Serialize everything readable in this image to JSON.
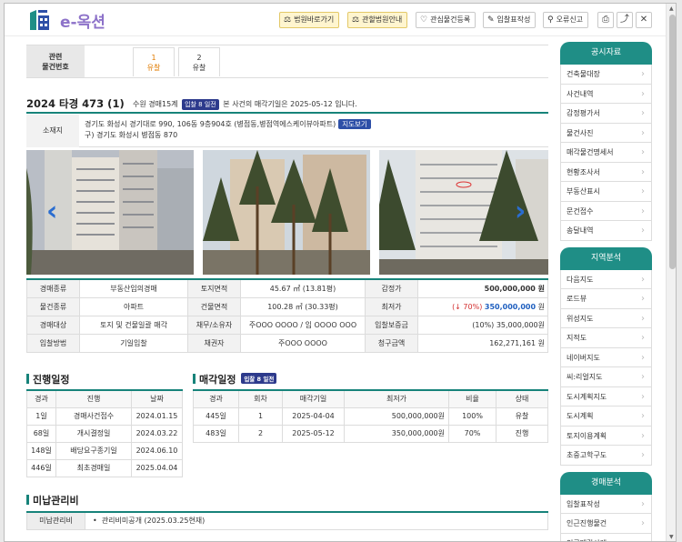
{
  "header": {
    "logo_text": "e-옥션",
    "buttons": [
      {
        "label": "법원바로가기",
        "icon": "gavel-icon",
        "style": "yellow"
      },
      {
        "label": "관할법원안내",
        "icon": "gavel-icon",
        "style": "yellow"
      },
      {
        "label": "관심물건등록",
        "icon": "heart-icon",
        "style": "plain"
      },
      {
        "label": "입찰표작성",
        "icon": "pencil-icon",
        "style": "plain"
      },
      {
        "label": "오류신고",
        "icon": "pin-icon",
        "style": "plain"
      }
    ],
    "icons": [
      "print-icon",
      "share-icon",
      "close-icon"
    ]
  },
  "tabs": {
    "head_line1": "관련",
    "head_line2": "물건번호",
    "items": [
      {
        "num": "1",
        "label": "유찰",
        "active": true
      },
      {
        "num": "2",
        "label": "유찰",
        "active": false
      }
    ]
  },
  "case": {
    "title": "2024 타경 473 (1)",
    "court": "수원 경매15계",
    "badge": "입찰 8 일전",
    "notice": "본 사건의 매각기일은 2025-05-12 입니다."
  },
  "location": {
    "label": "소재지",
    "line1": "경기도 화성시 경기대로 990, 106동 9층904호 (병점동,병점역에스케이뷰아파트)",
    "map_button": "지도보기",
    "line2": "구) 경기도 화성시 병점동 870"
  },
  "info_table": [
    [
      "경매종류",
      "부동산임의경매",
      "토지면적",
      "45.67 ㎡ (13.81평)",
      "감정가",
      "500,000,000 원"
    ],
    [
      "물건종류",
      "아파트",
      "건물면적",
      "100.28 ㎡ (30.33평)",
      "최저가",
      "(↓ 70%) 350,000,000 원"
    ],
    [
      "경매대상",
      "토지 및 건물일괄 매각",
      "채무/소유자",
      "주OOO OOOO / 임 OOOO OOO",
      "입찰보증금",
      "(10%) 35,000,000원"
    ],
    [
      "입찰방법",
      "기일입찰",
      "채권자",
      "주OOO OOOO",
      "청구금액",
      "162,271,161 원"
    ]
  ],
  "min_price": {
    "pct": "(↓ 70%)",
    "amount": "350,000,000",
    "unit": "원"
  },
  "progress": {
    "title": "진행일정",
    "columns": [
      "경과",
      "진행",
      "날짜"
    ],
    "rows": [
      [
        "1일",
        "경매사건접수",
        "2024.01.15"
      ],
      [
        "68일",
        "개시결정일",
        "2024.03.22"
      ],
      [
        "148일",
        "배당요구종기일",
        "2024.06.10"
      ],
      [
        "446일",
        "최초경매일",
        "2025.04.04"
      ]
    ]
  },
  "sale": {
    "title": "매각일정",
    "badge": "입찰 8 일전",
    "columns": [
      "경과",
      "회차",
      "매각기일",
      "최저가",
      "비율",
      "상태"
    ],
    "rows": [
      [
        "445일",
        "1",
        "2025-04-04",
        "500,000,000원",
        "100%",
        "유찰"
      ],
      [
        "483일",
        "2",
        "2025-05-12",
        "350,000,000원",
        "70%",
        "진행"
      ]
    ]
  },
  "fees": {
    "title": "미납관리비",
    "label": "미납관리비",
    "value": "관리비미공개 (2025.03.25현재)"
  },
  "sidebar": [
    {
      "title": "공시자료",
      "items": [
        "건축물대장",
        "사건내역",
        "감정평가서",
        "물건사진",
        "매각물건명세서",
        "현황조사서",
        "부동산표시",
        "문건접수",
        "송달내역"
      ]
    },
    {
      "title": "지역분석",
      "items": [
        "다음지도",
        "로드뷰",
        "위성지도",
        "지적도",
        "네이버지도",
        "씨:리얼지도",
        "도시계획지도",
        "도시계획",
        "토지이용계획",
        "초중고학구도"
      ]
    },
    {
      "title": "경매분석",
      "items": [
        "입찰표작성",
        "인근진행물건",
        "인근매각사례"
      ]
    }
  ],
  "colors": {
    "accent": "#17837a",
    "badge": "#2d3a8c",
    "logo": "#8d72c9",
    "min_price": "#d32f2f",
    "min_amount": "#1f5fbf"
  }
}
